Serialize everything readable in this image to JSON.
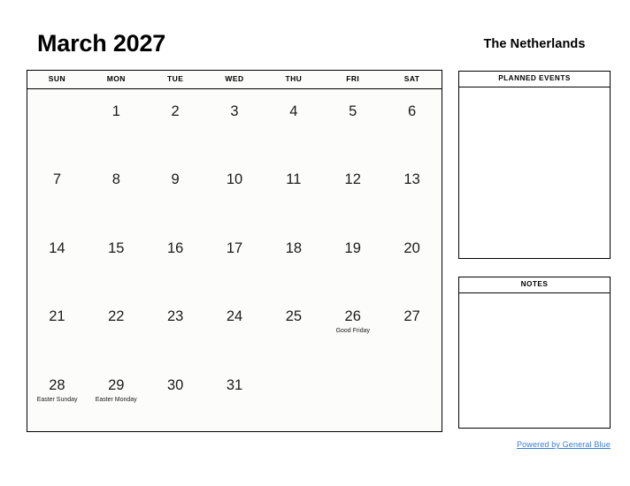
{
  "calendar": {
    "title": "March 2027",
    "weekdays": [
      "SUN",
      "MON",
      "TUE",
      "WED",
      "THU",
      "FRI",
      "SAT"
    ],
    "weeks": [
      [
        {
          "day": "",
          "event": ""
        },
        {
          "day": "1",
          "event": ""
        },
        {
          "day": "2",
          "event": ""
        },
        {
          "day": "3",
          "event": ""
        },
        {
          "day": "4",
          "event": ""
        },
        {
          "day": "5",
          "event": ""
        },
        {
          "day": "6",
          "event": ""
        }
      ],
      [
        {
          "day": "7",
          "event": ""
        },
        {
          "day": "8",
          "event": ""
        },
        {
          "day": "9",
          "event": ""
        },
        {
          "day": "10",
          "event": ""
        },
        {
          "day": "11",
          "event": ""
        },
        {
          "day": "12",
          "event": ""
        },
        {
          "day": "13",
          "event": ""
        }
      ],
      [
        {
          "day": "14",
          "event": ""
        },
        {
          "day": "15",
          "event": ""
        },
        {
          "day": "16",
          "event": ""
        },
        {
          "day": "17",
          "event": ""
        },
        {
          "day": "18",
          "event": ""
        },
        {
          "day": "19",
          "event": ""
        },
        {
          "day": "20",
          "event": ""
        }
      ],
      [
        {
          "day": "21",
          "event": ""
        },
        {
          "day": "22",
          "event": ""
        },
        {
          "day": "23",
          "event": ""
        },
        {
          "day": "24",
          "event": ""
        },
        {
          "day": "25",
          "event": ""
        },
        {
          "day": "26",
          "event": "Good Friday"
        },
        {
          "day": "27",
          "event": ""
        }
      ],
      [
        {
          "day": "28",
          "event": "Easter Sunday"
        },
        {
          "day": "29",
          "event": "Easter Monday"
        },
        {
          "day": "30",
          "event": ""
        },
        {
          "day": "31",
          "event": ""
        },
        {
          "day": "",
          "event": ""
        },
        {
          "day": "",
          "event": ""
        },
        {
          "day": "",
          "event": ""
        }
      ]
    ]
  },
  "sidebar": {
    "region_title": "The Netherlands",
    "planned_events": {
      "header": "PLANNED EVENTS",
      "content": ""
    },
    "notes": {
      "header": "NOTES",
      "content": ""
    }
  },
  "footer": {
    "link_label": "Powered by General Blue",
    "link_color": "#3b7dd8"
  }
}
